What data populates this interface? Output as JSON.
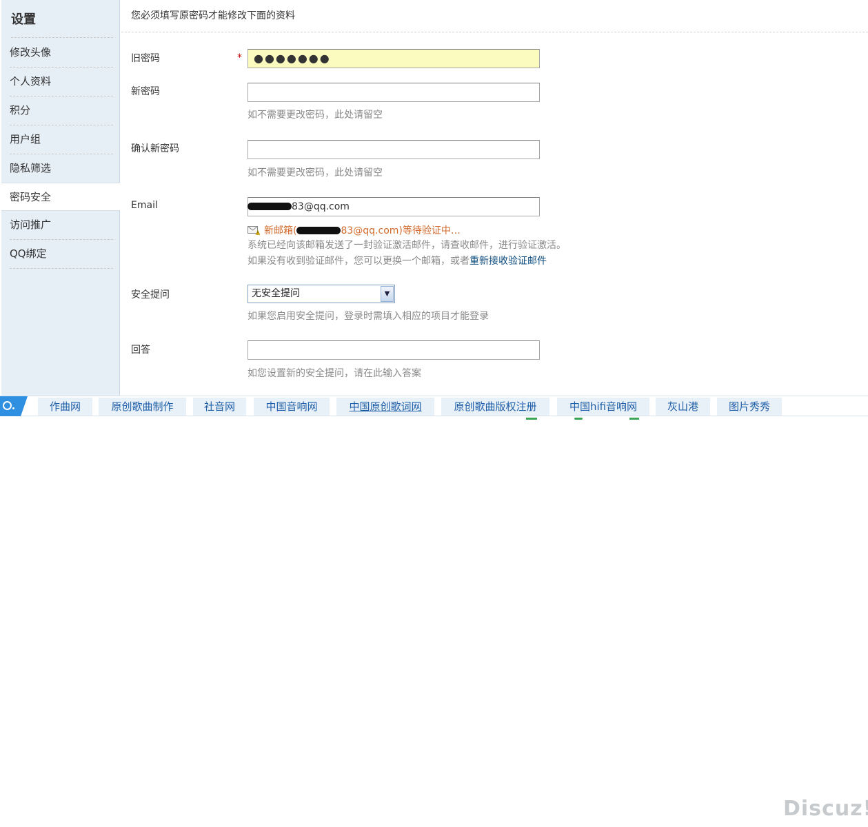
{
  "sidebar": {
    "title": "设置",
    "items": [
      {
        "label": "修改头像"
      },
      {
        "label": "个人资料"
      },
      {
        "label": "积分"
      },
      {
        "label": "用户组"
      },
      {
        "label": "隐私筛选"
      },
      {
        "label": "密码安全",
        "active": true
      },
      {
        "label": "访问推广"
      },
      {
        "label": "QQ绑定"
      }
    ]
  },
  "form": {
    "note": "您必须填写原密码才能修改下面的资料",
    "old_password": {
      "label": "旧密码",
      "required_mark": "*",
      "value": "●●●●●●●"
    },
    "new_password": {
      "label": "新密码",
      "value": "",
      "hint": "如不需要更改密码，此处请留空"
    },
    "confirm_password": {
      "label": "确认新密码",
      "value": "",
      "hint": "如不需要更改密码，此处请留空"
    },
    "email": {
      "label": "Email",
      "value_visible": "83@qq.com",
      "pending_prefix": "新邮箱(",
      "pending_suffix": "83@qq.com)等待验证中…",
      "sent_note": "系统已经向该邮箱发送了一封验证激活邮件，请查收邮件，进行验证激活。",
      "not_received_note": "如果没有收到验证邮件，您可以更换一个邮箱，或者",
      "resend_link": "重新接收验证邮件"
    },
    "security_question": {
      "label": "安全提问",
      "selected": "无安全提问",
      "hint": "如果您启用安全提问，登录时需填入相应的项目才能登录"
    },
    "answer": {
      "label": "回答",
      "value": "",
      "hint": "如您设置新的安全提问，请在此输入答案"
    }
  },
  "navbar": {
    "items": [
      {
        "label": "作曲网"
      },
      {
        "label": "原创歌曲制作"
      },
      {
        "label": "社音网"
      },
      {
        "label": "中国音响网"
      },
      {
        "label": "中国原创歌词网"
      },
      {
        "label": "原创歌曲版权注册"
      },
      {
        "label": "中国hifi音响网"
      },
      {
        "label": "灰山港"
      },
      {
        "label": "图片秀秀"
      }
    ]
  },
  "watermark": "Discuz!",
  "colors": {
    "sidebar_bg": "#e6eef6",
    "link": "#1f5fa8",
    "pending": "#d26a2b",
    "filled_field": "#fbfbbf"
  }
}
